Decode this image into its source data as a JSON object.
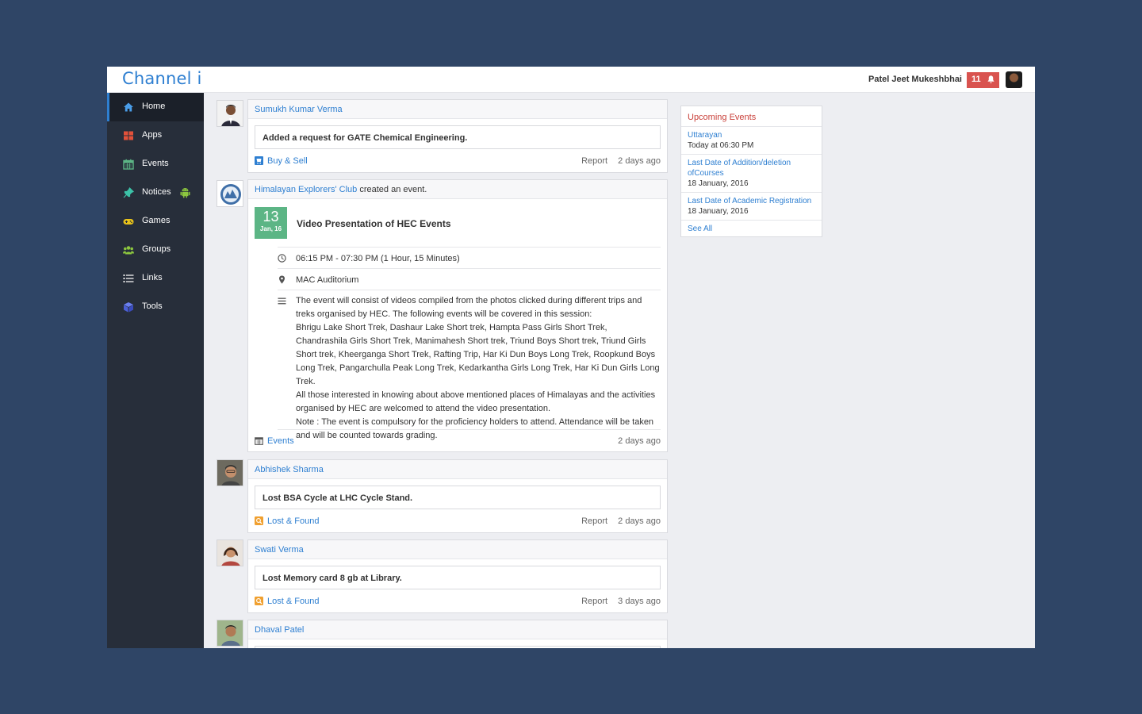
{
  "app": {
    "brand": "Channel i"
  },
  "header": {
    "user_name": "Patel Jeet Mukeshbhai",
    "notification_count": "11"
  },
  "sidebar": {
    "items": [
      {
        "label": "Home",
        "icon": "home-icon",
        "active": true
      },
      {
        "label": "Apps",
        "icon": "apps-icon"
      },
      {
        "label": "Events",
        "icon": "calendar-icon"
      },
      {
        "label": "Notices",
        "icon": "pin-icon"
      },
      {
        "label": "Games",
        "icon": "gamepad-icon"
      },
      {
        "label": "Groups",
        "icon": "groups-icon"
      },
      {
        "label": "Links",
        "icon": "list-icon"
      },
      {
        "label": "Tools",
        "icon": "cube-icon"
      }
    ]
  },
  "feed": {
    "post1": {
      "author": "Sumukh Kumar Verma",
      "message": "Added a request for GATE Chemical Engineering.",
      "category": "Buy & Sell",
      "report": "Report",
      "time": "2 days ago"
    },
    "event": {
      "club": "Himalayan Explorers' Club",
      "action": "created an event.",
      "date_day": "13",
      "date_month": "Jan, 16",
      "title": "Video Presentation of HEC Events",
      "time_range": "06:15 PM - 07:30 PM (1 Hour, 15 Minutes)",
      "location": "MAC Auditorium",
      "description": [
        "The event will consist of  videos compiled from the photos clicked during different trips and treks organised by HEC. The following events will be covered in this session:",
        "Bhrigu Lake Short Trek, Dashaur Lake Short trek, Hampta Pass Girls Short Trek, Chandrashila Girls Short Trek, Manimahesh Short trek, Triund Boys Short trek, Triund Girls Short trek, Kheerganga Short Trek, Rafting Trip, Har Ki Dun Boys Long Trek, Roopkund Boys Long Trek, Pangarchulla Peak Long Trek, Kedarkantha Girls Long Trek, Har Ki Dun Girls Long Trek.",
        "All those interested in knowing about above mentioned places of Himalayas and the activities organised by HEC are welcomed to attend the video presentation.",
        "Note : The event is compulsory for the proficiency holders to attend. Attendance will be taken and will be counted towards grading."
      ],
      "category": "Events",
      "time": "2 days ago"
    },
    "post2": {
      "author": "Abhishek Sharma",
      "message": "Lost BSA Cycle at LHC Cycle Stand.",
      "category": "Lost & Found",
      "report": "Report",
      "time": "2 days ago"
    },
    "post3": {
      "author": "Swati Verma",
      "message": "Lost Memory card 8 gb at Library.",
      "category": "Lost & Found",
      "report": "Report",
      "time": "3 days ago"
    },
    "post4": {
      "author": "Dhaval Patel"
    }
  },
  "upcoming": {
    "title": "Upcoming Events",
    "items": [
      {
        "title": "Uttarayan",
        "date": "Today at 06:30 PM"
      },
      {
        "title": "Last Date of Addition/deletion ofCourses",
        "date": "18 January, 2016"
      },
      {
        "title": "Last Date of Academic Registration",
        "date": "18 January, 2016"
      }
    ],
    "see_all": "See All"
  },
  "colors": {
    "primary": "#2e7fd1",
    "sidebar": "#272e3a",
    "danger": "#d9534f",
    "event_green": "#5cb585",
    "background": "#2f4566"
  }
}
